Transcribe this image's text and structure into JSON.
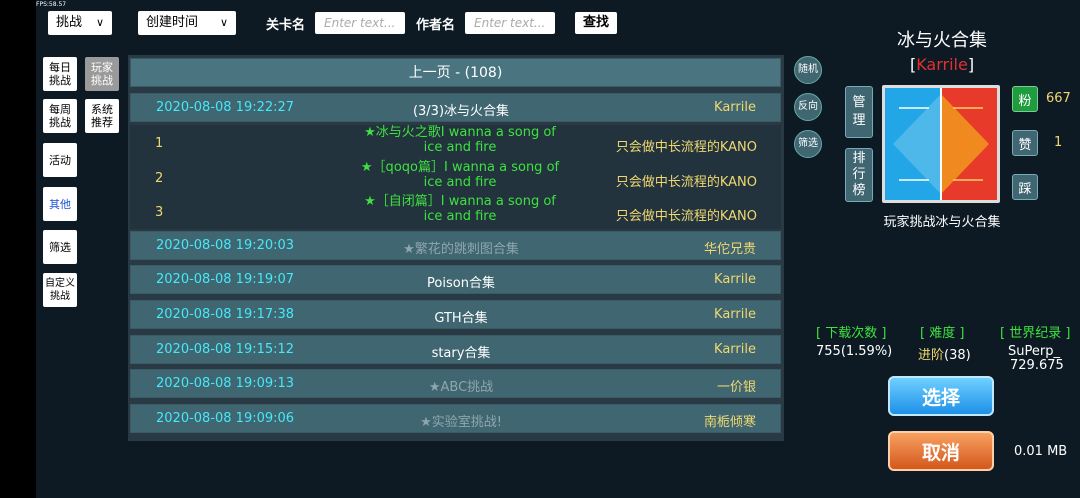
{
  "fps": "FPS:58.57",
  "filters": {
    "mode_select": "挑战",
    "sort_select": "创建时间",
    "level_label": "关卡名",
    "level_placeholder": "Enter text...",
    "author_label": "作者名",
    "author_placeholder": "Enter text...",
    "search_button": "查找"
  },
  "categories": [
    {
      "label": "每日\n挑战"
    },
    {
      "label": "玩家\n挑战"
    },
    {
      "label": "每周\n挑战"
    },
    {
      "label": "系统\n推荐"
    },
    {
      "label": "活动"
    },
    {
      "label": "其他"
    },
    {
      "label": "筛选"
    },
    {
      "label": "自定义\n挑战"
    }
  ],
  "list": {
    "header": "上一页 - (108)",
    "expanded": {
      "date": "2020-08-08 19:22:27",
      "title": "(3/3)冰与火合集",
      "author": "Karrile",
      "stages": [
        {
          "num": "1",
          "title": "★冰与火之歌I wanna a song of ice and fire",
          "author": "只会做中长流程的KANO"
        },
        {
          "num": "2",
          "title": "★［qoqo篇］I wanna a song of ice and fire",
          "author": "只会做中长流程的KANO"
        },
        {
          "num": "3",
          "title": "★［自闭篇］I wanna a song of ice and fire",
          "author": "只会做中长流程的KANO"
        }
      ]
    },
    "rows": [
      {
        "date": "2020-08-08 19:20:03",
        "title": "★繁花的跳刺图合集",
        "author": "华佗兄贵",
        "dim": true
      },
      {
        "date": "2020-08-08 19:19:07",
        "title": "Poison合集",
        "author": "Karrile",
        "dim": false
      },
      {
        "date": "2020-08-08 19:17:38",
        "title": "GTH合集",
        "author": "Karrile",
        "dim": false
      },
      {
        "date": "2020-08-08 19:15:12",
        "title": "stary合集",
        "author": "Karrile",
        "dim": false
      },
      {
        "date": "2020-08-08 19:09:13",
        "title": "★ABC挑战",
        "author": "一价银",
        "dim": true
      },
      {
        "date": "2020-08-08 19:09:06",
        "title": "★实验室挑战!",
        "author": "南栀倾寒",
        "dim": true
      }
    ]
  },
  "side_buttons": {
    "random": "随机",
    "reverse": "反向",
    "filter": "筛选"
  },
  "detail": {
    "title": "冰与火合集",
    "author_prefix": "[",
    "author": "Karrile",
    "author_suffix": "]",
    "manage": "管理",
    "ranking": "排行榜",
    "fans_icon": "粉",
    "fans_count": "667",
    "like": "赞",
    "like_count": "1",
    "dislike": "踩",
    "caption": "玩家挑战冰与火合集",
    "downloads_label": "[ 下载次数 ]",
    "downloads_value": "755(1.59%)",
    "difficulty_label": "[ 难度 ]",
    "difficulty_value": "进阶",
    "difficulty_num": "(38)",
    "record_label": "[ 世界纪录 ]",
    "record_holder": "SuPerp_",
    "record_time": "729.675",
    "select_button": "选择",
    "cancel_button": "取消",
    "file_size": "0.01 MB"
  },
  "colors": {
    "date": "#46e8f8",
    "author": "#f0d870",
    "green": "#3ee23e",
    "author_red": "#e23030"
  }
}
